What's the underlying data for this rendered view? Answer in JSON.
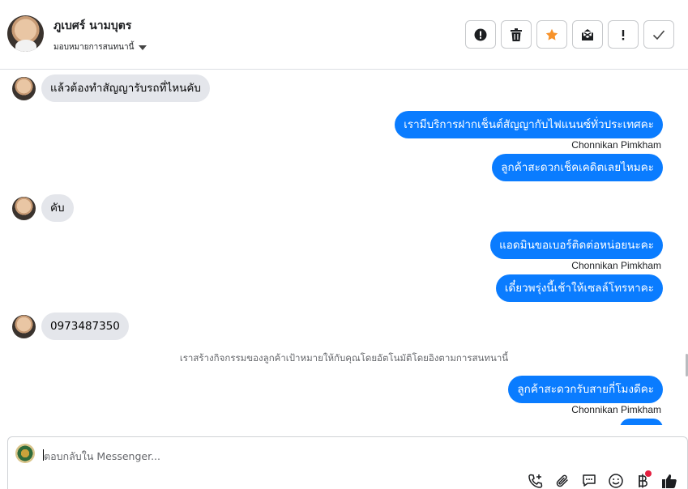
{
  "header": {
    "contact_name": "ภูเบศร์ นามบุตร",
    "assign_label": "มอบหมายการสนทนานี้"
  },
  "actions": [
    {
      "name": "mark-spam-button",
      "icon": "alert-circle-icon"
    },
    {
      "name": "delete-button",
      "icon": "trash-icon"
    },
    {
      "name": "star-button",
      "icon": "star-icon",
      "color": "#f7922a"
    },
    {
      "name": "mark-unread-button",
      "icon": "envelope-icon"
    },
    {
      "name": "follow-up-button",
      "icon": "exclamation-icon"
    },
    {
      "name": "mark-done-button",
      "icon": "check-icon"
    }
  ],
  "messages": {
    "m1": "แล้วต้องทำสัญญารับรถที่ไหนคับ",
    "m2": "เรามีบริการฝากเช็นต์สัญญากับไฟแนนซ์ทั่วประเทศคะ",
    "m2_sender": "Chonnikan Pimkham",
    "m3": "ลูกค้าสะดวกเช็คเคดิตเลยไหมคะ",
    "m4": "คับ",
    "m5": "แอดมินขอเบอร์ติดต่อหน่อยนะคะ",
    "m5_sender": "Chonnikan Pimkham",
    "m6": "เดี๋ยวพรุ่งนี้เช้าให้เซลล์โทรหาคะ",
    "m7": "0973487350",
    "system_note": "เราสร้างกิจกรรมของลูกค้าเป้าหมายให้กับคุณโดยอัตโนมัติโดยอิงตามการสนทนานี้",
    "m8": "ลูกค้าสะดวกรับสายกี่โมงดีคะ",
    "m8_sender": "Chonnikan Pimkham"
  },
  "composer": {
    "placeholder": "ตอบกลับใน Messenger..."
  },
  "colors": {
    "outgoing_bubble": "#0a7cff",
    "incoming_bubble": "#e4e6eb",
    "badge_dot": "#e41e3f"
  }
}
